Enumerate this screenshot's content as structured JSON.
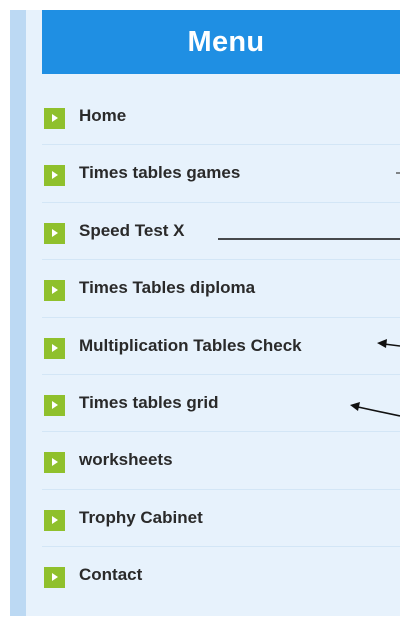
{
  "header": {
    "title": "Menu"
  },
  "menu": {
    "items": [
      {
        "label": "Home",
        "icon": "play-arrow-icon"
      },
      {
        "label": "Times tables games",
        "icon": "play-arrow-icon"
      },
      {
        "label": "Speed Test X",
        "icon": "play-arrow-icon"
      },
      {
        "label": "Times Tables diploma",
        "icon": "play-arrow-icon"
      },
      {
        "label": "Multiplication Tables Check",
        "icon": "play-arrow-icon"
      },
      {
        "label": "Times tables grid",
        "icon": "play-arrow-icon"
      },
      {
        "label": "worksheets",
        "icon": "play-arrow-icon"
      },
      {
        "label": "Trophy Cabinet",
        "icon": "play-arrow-icon"
      },
      {
        "label": "Contact",
        "icon": "play-arrow-icon"
      }
    ]
  },
  "colors": {
    "header_bg": "#1f8fe3",
    "panel_bg": "#e7f2fc",
    "rail": "#bcd9f3",
    "icon_bg": "#8fc02c",
    "text": "#2a2a2a",
    "annotation": "#111111"
  }
}
